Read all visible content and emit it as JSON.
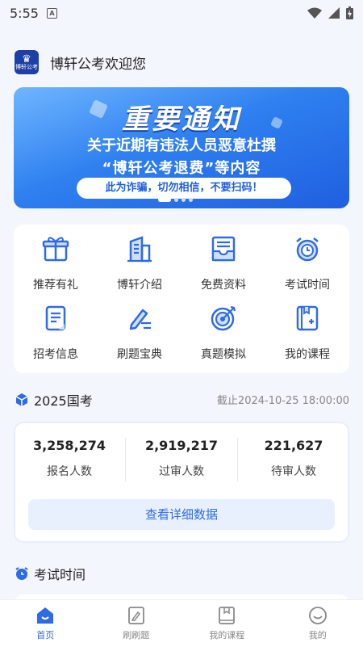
{
  "status_bar": {
    "time": "5:55",
    "sim_label": "A"
  },
  "header": {
    "logo_text": "博轩公考",
    "title": "博轩公考欢迎您"
  },
  "banner": {
    "headline": "重要通知",
    "line1": "关于近期有违法人员恶意杜撰",
    "line2": "“博轩公考退费”等内容",
    "pill": "此为诈骗，切勿相信，不要扫码！",
    "dot_count": 4,
    "active_dot": 0
  },
  "grid": {
    "items": [
      {
        "label": "推荐有礼",
        "icon": "gift-icon"
      },
      {
        "label": "博轩介绍",
        "icon": "building-icon"
      },
      {
        "label": "免费资料",
        "icon": "tray-icon"
      },
      {
        "label": "考试时间",
        "icon": "alarm-clock-icon"
      },
      {
        "label": "招考信息",
        "icon": "document-icon"
      },
      {
        "label": "刷题宝典",
        "icon": "pen-icon"
      },
      {
        "label": "真题模拟",
        "icon": "target-icon"
      },
      {
        "label": "我的课程",
        "icon": "book-icon"
      }
    ]
  },
  "exam_section": {
    "title": "2025国考",
    "deadline": "截止2024-10-25 18:00:00",
    "stats": [
      {
        "value": "3,258,274",
        "label": "报名人数"
      },
      {
        "value": "2,919,217",
        "label": "过审人数"
      },
      {
        "value": "221,627",
        "label": "待审人数"
      }
    ],
    "detail_button": "查看详细数据"
  },
  "time_section": {
    "title": "考试时间"
  },
  "tabbar": {
    "tabs": [
      {
        "label": "首页",
        "icon": "home-icon",
        "active": true
      },
      {
        "label": "刷刷题",
        "icon": "quiz-icon",
        "active": false
      },
      {
        "label": "我的课程",
        "icon": "course-icon",
        "active": false
      },
      {
        "label": "我的",
        "icon": "profile-icon",
        "active": false
      }
    ]
  },
  "colors": {
    "accent": "#2e6be5",
    "background": "#f3f6fc",
    "banner": "#2f80f0"
  }
}
